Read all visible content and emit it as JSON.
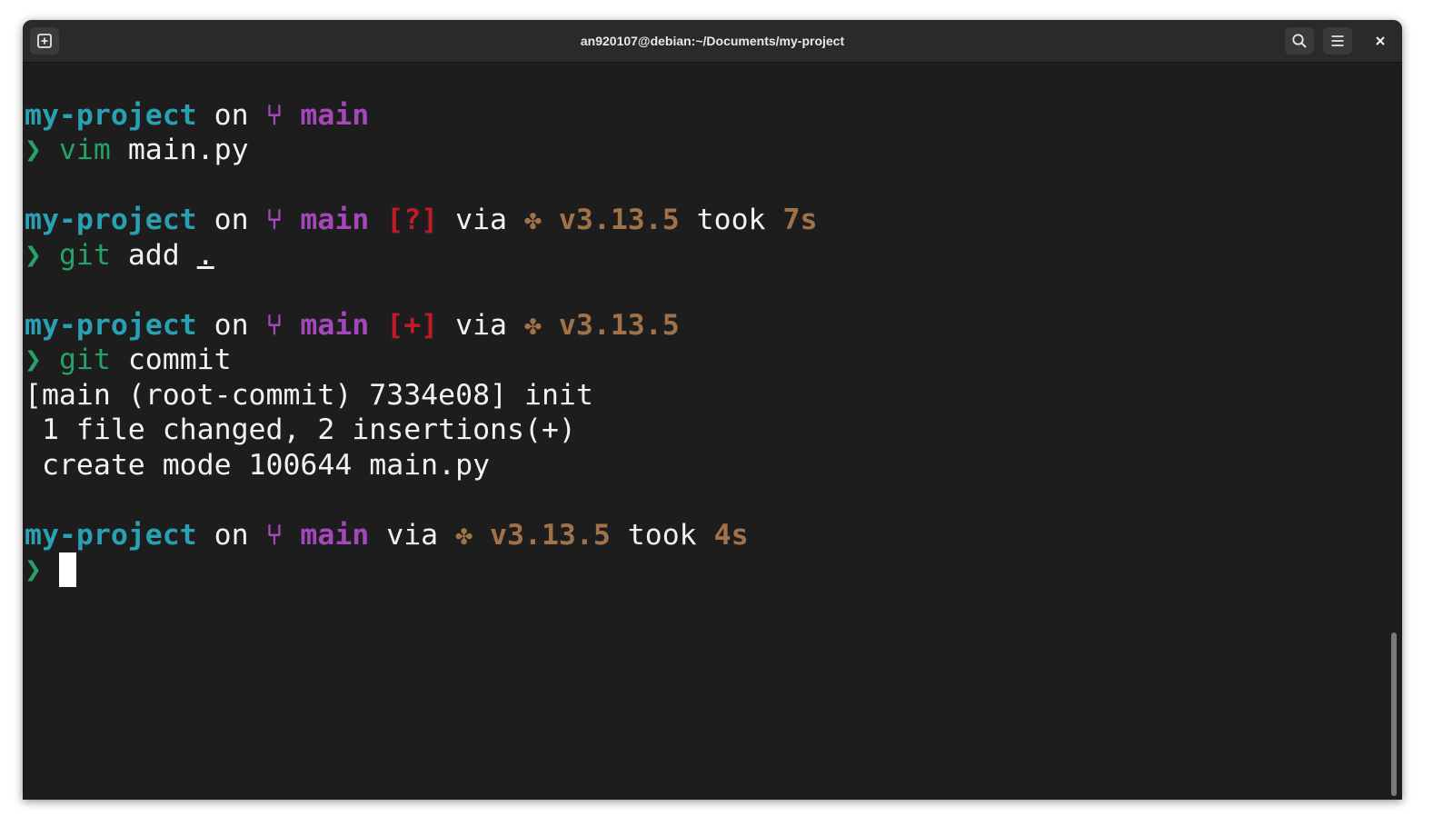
{
  "window": {
    "title": "an920107@debian:~/Documents/my-project"
  },
  "icons": {
    "new_tab": "new-tab-icon",
    "search": "search-icon",
    "menu": "hamburger-menu-icon",
    "close": "close-icon",
    "branch": "git-branch-icon",
    "python": "python-icon"
  },
  "colors": {
    "directory": "#2aa1b3",
    "branch": "#a347ba",
    "git_status": "#c01c28",
    "python_version": "#a0724a",
    "duration": "#a0724a",
    "prompt_arrow": "#26a269",
    "command": "#26a269",
    "background": "#1d1d1d"
  },
  "terminal": {
    "blocks": [
      {
        "prompt": {
          "dir": "my-project",
          "on": "on",
          "branch_glyph": "⑂",
          "branch": "main",
          "status": "",
          "via": "",
          "python_glyph": "",
          "python_version": "",
          "took": "",
          "duration": ""
        },
        "arrow": "❯",
        "cmd": "vim",
        "args": "main.py",
        "output": []
      },
      {
        "prompt": {
          "dir": "my-project",
          "on": "on",
          "branch_glyph": "⑂",
          "branch": "main",
          "status": "[?]",
          "via": "via",
          "python_glyph": "✤",
          "python_version": "v3.13.5",
          "took": "took",
          "duration": "7s"
        },
        "arrow": "❯",
        "cmd": "git",
        "args": "add",
        "args_underlined": ".",
        "output": []
      },
      {
        "prompt": {
          "dir": "my-project",
          "on": "on",
          "branch_glyph": "⑂",
          "branch": "main",
          "status": "[+]",
          "via": "via",
          "python_glyph": "✤",
          "python_version": "v3.13.5",
          "took": "",
          "duration": ""
        },
        "arrow": "❯",
        "cmd": "git",
        "args": "commit",
        "output": [
          "[main (root-commit) 7334e08] init",
          " 1 file changed, 2 insertions(+)",
          " create mode 100644 main.py"
        ]
      },
      {
        "prompt": {
          "dir": "my-project",
          "on": "on",
          "branch_glyph": "⑂",
          "branch": "main",
          "status": "",
          "via": "via",
          "python_glyph": "✤",
          "python_version": "v3.13.5",
          "took": "took",
          "duration": "4s"
        },
        "arrow": "❯",
        "cmd": "",
        "args": "",
        "output": []
      }
    ]
  }
}
